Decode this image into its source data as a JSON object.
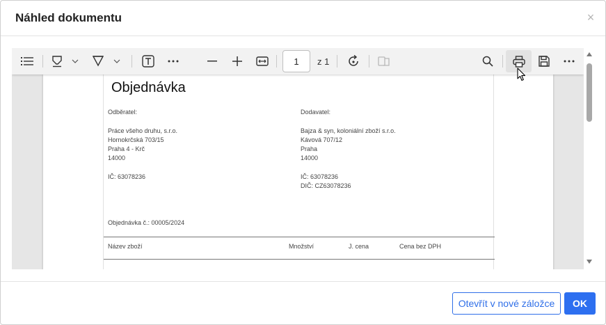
{
  "dialog": {
    "title": "Náhled dokumentu",
    "close_symbol": "×"
  },
  "toolbar": {
    "page_number": "1",
    "page_of": "z 1",
    "icons": [
      "list-icon",
      "highlight-icon",
      "chevron-down-icon",
      "draw-icon",
      "chevron-down-icon",
      "text-icon",
      "more-icon",
      "zoom-out-icon",
      "zoom-in-icon",
      "fit-width-icon",
      "rotate-icon",
      "page-view-icon",
      "search-icon",
      "print-icon",
      "save-icon",
      "more-icon"
    ]
  },
  "document": {
    "title": "Objednávka",
    "buyer": {
      "label": "Odběratel:",
      "name": "Práce všeho druhu, s.r.o.",
      "street": "Hornokrčská 703/15",
      "city": "Praha 4 - Krč",
      "zip": "14000",
      "ic": "IČ: 63078236"
    },
    "supplier": {
      "label": "Dodavatel:",
      "name": "Bajza & syn, koloniální zboží s.r.o.",
      "street": "Kávová 707/12",
      "city": "Praha",
      "zip": "14000",
      "ic": "IČ: 63078236",
      "dic": "DIČ: CZ63078236"
    },
    "order_number": "Objednávka č.:  00005/2024",
    "columns": [
      "Název zboží",
      "Množství",
      "J. cena",
      "Cena bez DPH"
    ]
  },
  "footer": {
    "open_tab_label": "Otevřít v nové záložce",
    "ok_label": "OK"
  },
  "colors": {
    "accent": "#2d6ff0",
    "viewer_background": "#e6e6e6"
  }
}
